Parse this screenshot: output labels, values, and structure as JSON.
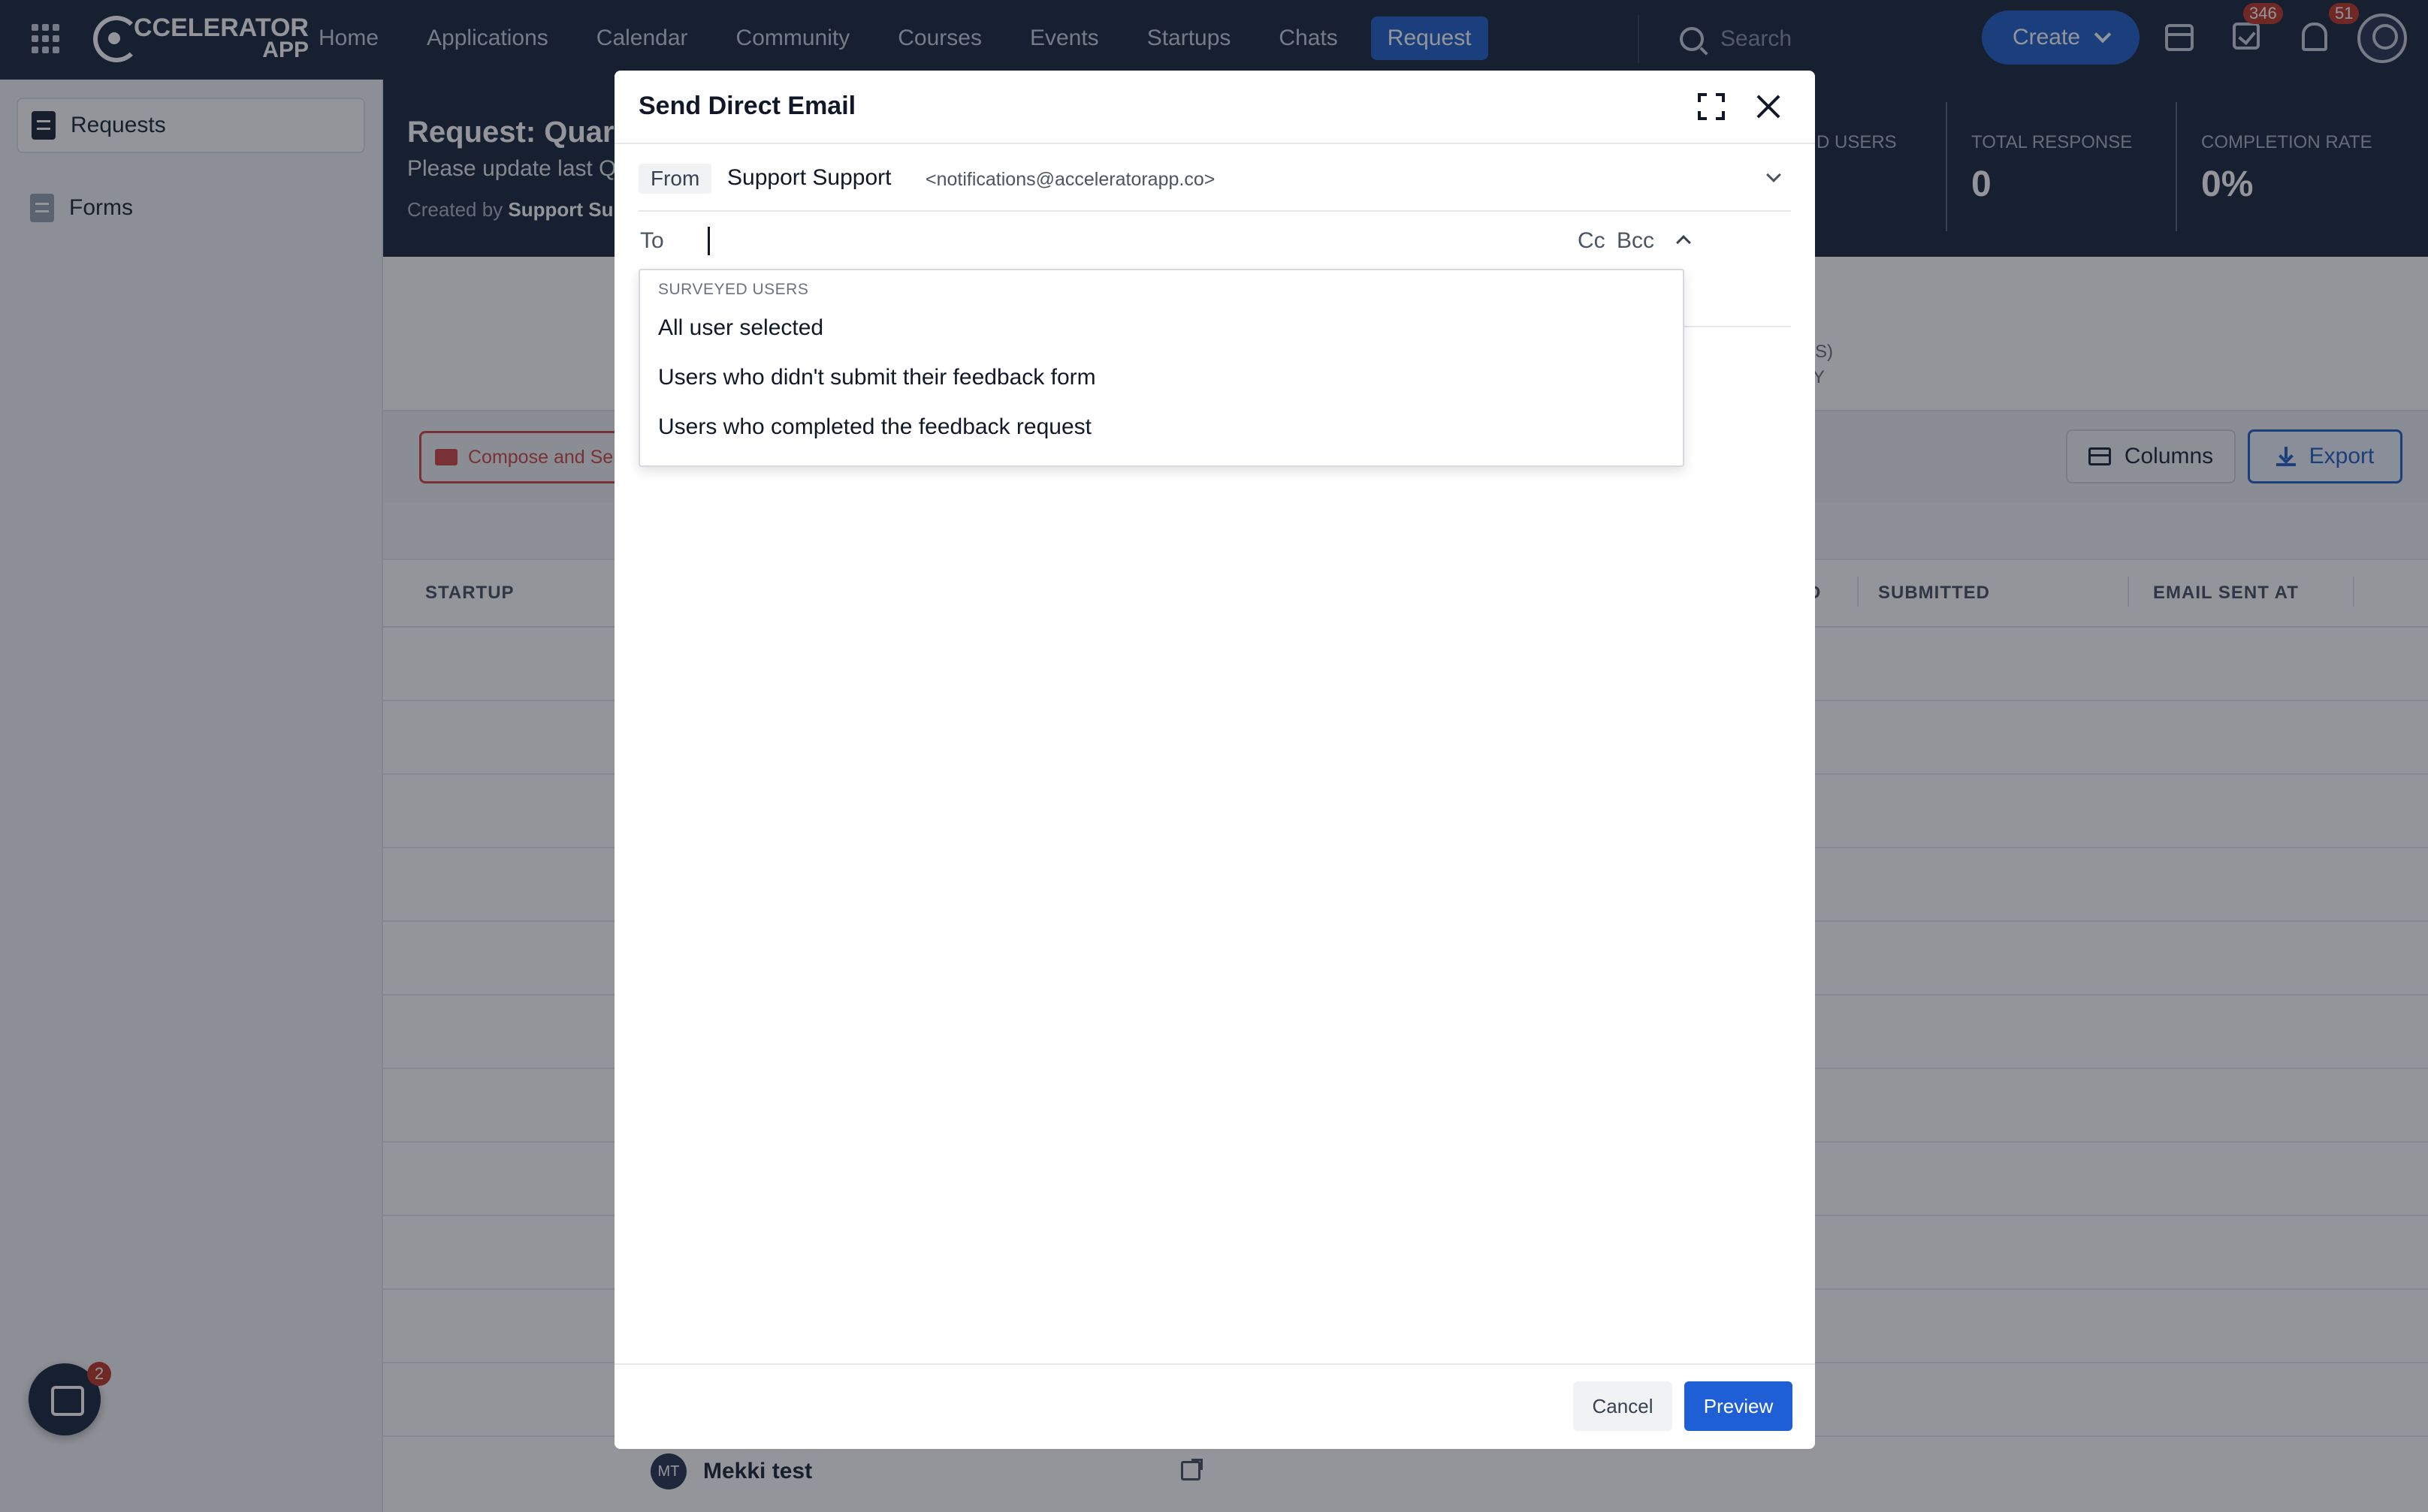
{
  "topnav": {
    "logo_line1": "CCELERATOR",
    "logo_line2": "APP",
    "items": [
      {
        "label": "Home"
      },
      {
        "label": "Applications"
      },
      {
        "label": "Calendar"
      },
      {
        "label": "Community"
      },
      {
        "label": "Courses"
      },
      {
        "label": "Events"
      },
      {
        "label": "Startups"
      },
      {
        "label": "Chats"
      },
      {
        "label": "Request",
        "active": true
      }
    ],
    "search_placeholder": "Search",
    "create_label": "Create",
    "tasks_badge": "346",
    "notifications_badge": "51",
    "icons": [
      "apps-grid-icon",
      "search-icon",
      "chevron-down-icon",
      "calendar-icon",
      "task-check-icon",
      "bell-icon",
      "user-avatar-icon"
    ]
  },
  "sidebar": {
    "items": [
      {
        "label": "Requests",
        "icon": "document-icon",
        "active": true
      },
      {
        "label": "Forms",
        "icon": "document-icon",
        "active": false
      }
    ]
  },
  "header": {
    "title": "Request: Quar",
    "description": "Please update last Q",
    "created_by_prefix": "Created by",
    "created_by_name": "Support Supp",
    "stats_partial_label": "D USERS",
    "stats": [
      {
        "label": "TOTAL RESPONSE",
        "value": "0"
      },
      {
        "label": "COMPLETION RATE",
        "value": "0%"
      }
    ]
  },
  "band": {
    "partial_line1": "IL(S)",
    "partial_line2": "LLY"
  },
  "toolbar": {
    "compose_label": "Compose and Ser",
    "columns_label": "Columns",
    "export_label": "Export"
  },
  "table": {
    "headers": [
      {
        "label": "STARTUP"
      },
      {
        "label": "D"
      },
      {
        "label": "SUBMITTED"
      },
      {
        "label": "EMAIL SENT AT"
      }
    ],
    "last_row": {
      "initials": "MT",
      "name": "Mekki test"
    }
  },
  "chat": {
    "badge": "2"
  },
  "modal": {
    "title": "Send Direct Email",
    "from_tag": "From",
    "from_name": "Support Support",
    "from_address": "<notifications@acceleratorapp.co>",
    "to_label": "To",
    "to_value": "",
    "cc_label": "Cc",
    "bcc_label": "Bcc",
    "dropdown": {
      "group_label": "SURVEYED USERS",
      "options": [
        {
          "label": "All user selected"
        },
        {
          "label": "Users who didn't submit their feedback form"
        },
        {
          "label": "Users who completed the feedback request"
        }
      ]
    },
    "cancel_label": "Cancel",
    "preview_label": "Preview"
  },
  "colors": {
    "nav_bg": "#1e2a3f",
    "accent": "#2563c9",
    "danger": "#d14a4a",
    "badge": "#c0392b"
  }
}
